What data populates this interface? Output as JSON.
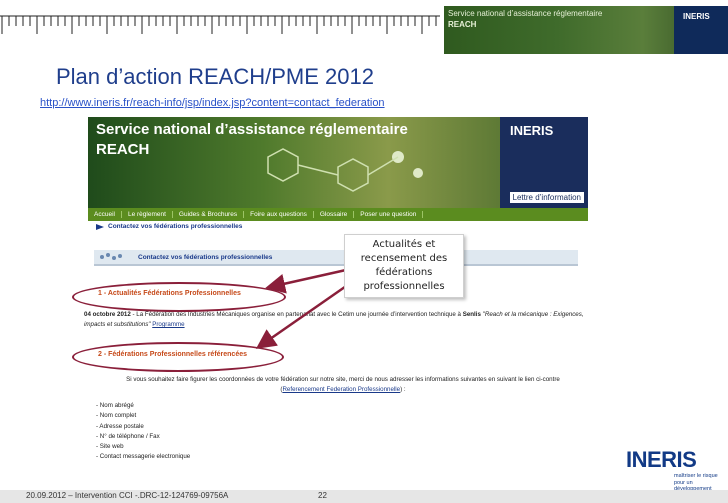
{
  "slide": {
    "title": "Plan d’action REACH/PME 2012",
    "url": "http://www.ineris.fr/reach-info/jsp/index.jsp?content=contact_federation",
    "footer_left": "20.09.2012 – Intervention CCI -.DRC-12-124769-09756A",
    "page_number": "22",
    "logo": {
      "name": "INERIS",
      "tagline": "maîtriser le risque pour un développement durable"
    }
  },
  "corner_banner": {
    "line1": "Service national d’assistance réglementaire",
    "line2": "REACH",
    "logo": "INERIS"
  },
  "site": {
    "banner": {
      "line1": "Service national d’assistance réglementaire",
      "line2": "REACH",
      "logo": "INERIS",
      "lettre": "Lettre d’information"
    },
    "nav": [
      "Accueil",
      "Le règlement",
      "Guides & Brochures",
      "Foire aux questions",
      "Glossaire",
      "Poser une question"
    ],
    "breadcrumb": "Contactez vos fédérations professionnelles",
    "section_title": "Contactez vos fédérations professionnelles",
    "heading1": "1 - Actualités Fédérations Professionnelles",
    "news": {
      "date": "04 octobre 2012",
      "text": " - La Fédération des Industries Mécaniques organise en partenariat avec le Cetim une journée d’intervention technique à ",
      "place": "Senlis",
      "quote": " \"Reach et la mécanique : Exigences, impacts et substitutions\" ",
      "link": "Programme"
    },
    "heading2": "2 - Fédérations Professionnelles référencées",
    "info": {
      "text": "Si vous souhaitez faire figurer les coordonnées de votre fédération sur notre site, merci de nous adresser les informations suivantes en suivant le lien ci-contre (",
      "link": "Referencement Federation Professionnelle",
      "end": ") :"
    },
    "requirements": [
      "- Nom abrégé",
      "- Nom complet",
      "- Adresse postale",
      "- N° de téléphone / Fax",
      "- Site web",
      "- Contact messagerie electronique"
    ]
  },
  "callout": {
    "lines": [
      "Actualités et",
      "recensement des",
      "fédérations",
      "professionnelles"
    ]
  },
  "colors": {
    "title": "#1f3e8c",
    "nav": "#5b8c1f",
    "heading": "#c64a1a",
    "arrow": "#8a1f3a"
  },
  "icons": [
    "breadcrumb-arrow-icon",
    "section-icon",
    "callout-arrow-icon"
  ]
}
